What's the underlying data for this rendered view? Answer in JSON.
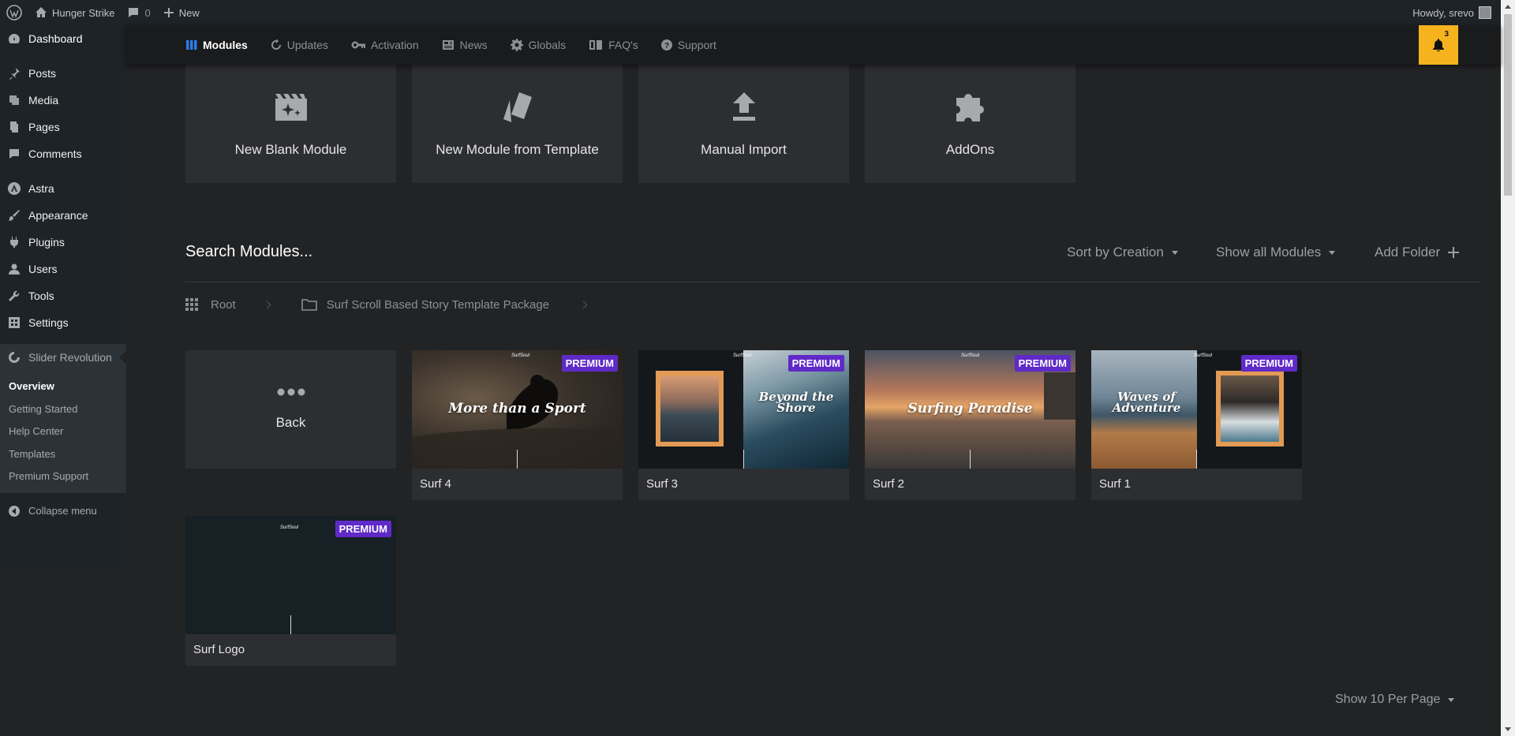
{
  "adminbar": {
    "site_name": "Hunger Strike",
    "comments_count": "0",
    "new_label": "New",
    "howdy": "Howdy, srevo"
  },
  "sidebar": {
    "dashboard": "Dashboard",
    "posts": "Posts",
    "media": "Media",
    "pages": "Pages",
    "comments": "Comments",
    "astra": "Astra",
    "appearance": "Appearance",
    "plugins": "Plugins",
    "users": "Users",
    "tools": "Tools",
    "settings": "Settings",
    "slider_revolution": "Slider Revolution",
    "submenu": [
      "Overview",
      "Getting Started",
      "Help Center",
      "Templates",
      "Premium Support"
    ],
    "collapse": "Collapse menu"
  },
  "topnav": {
    "items": [
      "Modules",
      "Updates",
      "Activation",
      "News",
      "Globals",
      "FAQ's",
      "Support"
    ],
    "notification_count": "3"
  },
  "tiles": [
    "New Blank Module",
    "New Module from Template",
    "Manual Import",
    "AddOns"
  ],
  "search": {
    "title": "Search Modules...",
    "sort": "Sort by Creation",
    "filter": "Show all Modules",
    "add_folder": "Add Folder"
  },
  "breadcrumb": {
    "root": "Root",
    "folder": "Surf Scroll Based Story Template Package"
  },
  "back_card": {
    "label": "Back"
  },
  "modules": [
    {
      "name": "Surf 4",
      "badge": "PREMIUM",
      "title": "More than a Sport"
    },
    {
      "name": "Surf 3",
      "badge": "PREMIUM",
      "title": "Beyond the Shore"
    },
    {
      "name": "Surf 2",
      "badge": "PREMIUM",
      "title": "Surfing Paradise"
    },
    {
      "name": "Surf 1",
      "badge": "PREMIUM",
      "title": "Waves of Adventure"
    },
    {
      "name": "Surf Logo",
      "badge": "PREMIUM",
      "title": ""
    }
  ],
  "thumb_logo": "SurfSoul",
  "pagination": {
    "per_page": "Show 10 Per Page"
  },
  "colors": {
    "accent": "#2d7be9",
    "premium": "#5f2ac8",
    "notification": "#f7b31e"
  }
}
